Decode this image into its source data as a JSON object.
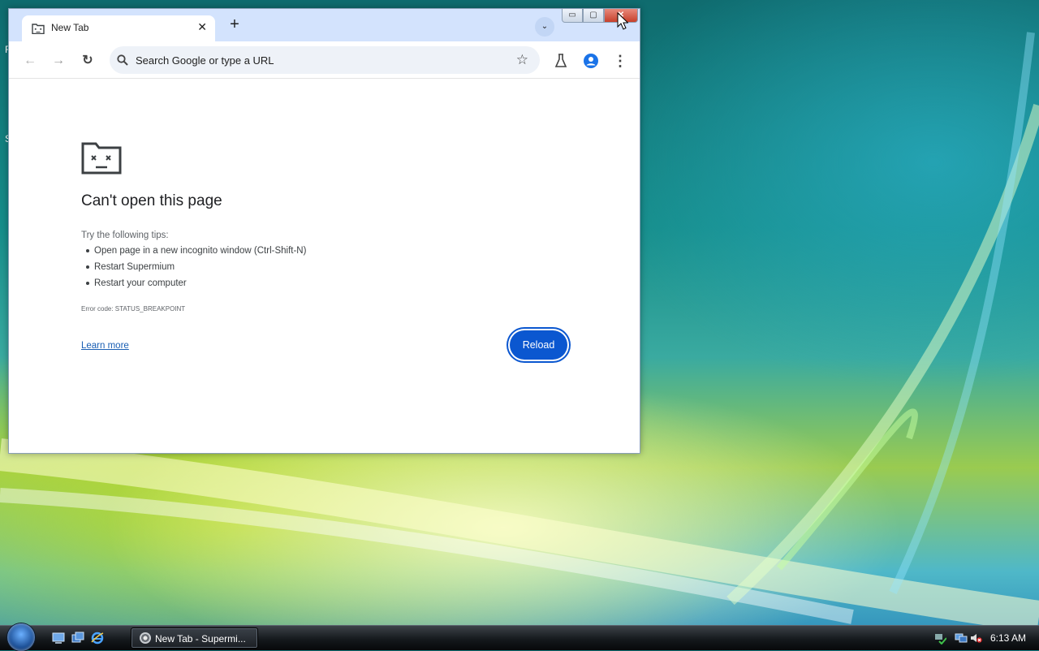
{
  "browser": {
    "tab": {
      "title": "New Tab",
      "close_glyph": "✕",
      "favicon": "sad-folder-icon"
    },
    "new_tab_glyph": "+",
    "tab_search_glyph": "⌄",
    "window_controls": {
      "minimize": "▭",
      "maximize": "▢",
      "close": "✕"
    },
    "toolbar": {
      "back_glyph": "←",
      "forward_glyph": "→",
      "reload_glyph": "↻",
      "omnibox_placeholder": "Search Google or type a URL",
      "bookmark_glyph": "☆",
      "menu_glyph": "⋮"
    }
  },
  "error_page": {
    "title": "Can't open this page",
    "tips_label": "Try the following tips:",
    "tips": [
      "Open page in a new incognito window (Ctrl-Shift-N)",
      "Restart Supermium",
      "Restart your computer"
    ],
    "error_code": "Error code: STATUS_BREAKPOINT",
    "learn_more": "Learn more",
    "reload_label": "Reload"
  },
  "taskbar": {
    "active_task_label": "New Tab - Supermi...",
    "clock": "6:13 AM"
  },
  "colors": {
    "titlebar": "#d3e3fd",
    "accent": "#0b57d0",
    "link": "#1a5fb4",
    "close_button": "#c7402c"
  }
}
